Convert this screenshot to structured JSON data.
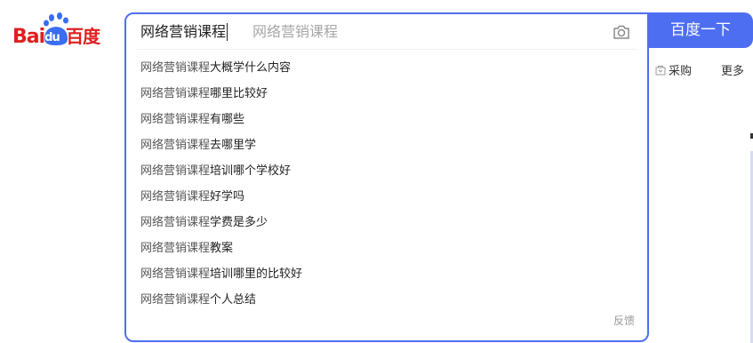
{
  "logo": {
    "bai": "Bai",
    "du": "du",
    "chinese": "百度"
  },
  "search": {
    "query": "网络营销课程",
    "placeholder": "网络营销课程",
    "button_label": "百度一下"
  },
  "suggestions": [
    {
      "prefix": "网络营销课程",
      "suffix": "大概学什么内容"
    },
    {
      "prefix": "网络营销课程",
      "suffix": "哪里比较好"
    },
    {
      "prefix": "网络营销课程",
      "suffix": "有哪些"
    },
    {
      "prefix": "网络营销课程",
      "suffix": "去哪里学"
    },
    {
      "prefix": "网络营销课程",
      "suffix": "培训哪个学校好"
    },
    {
      "prefix": "网络营销课程",
      "suffix": "好学吗"
    },
    {
      "prefix": "网络营销课程",
      "suffix": "学费是多少"
    },
    {
      "prefix": "网络营销课程",
      "suffix": "教案"
    },
    {
      "prefix": "网络营销课程",
      "suffix": "培训哪里的比较好"
    },
    {
      "prefix": "网络营销课程",
      "suffix": "个人总结"
    }
  ],
  "feedback_label": "反馈",
  "nav": {
    "purchase": "采购",
    "more": "更多"
  },
  "colors": {
    "brand_blue": "#4e6ef2",
    "logo_red": "#de1f1f"
  },
  "icons": {
    "camera": "camera-icon",
    "cart": "cart-icon",
    "paw": "baidu-paw-icon"
  }
}
